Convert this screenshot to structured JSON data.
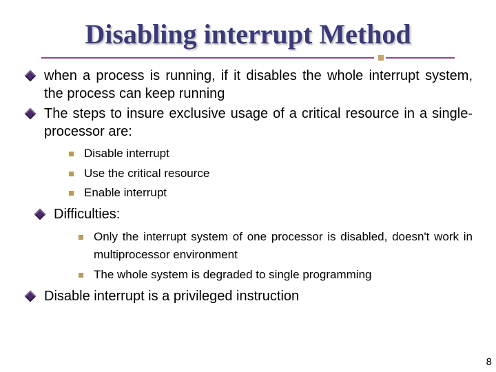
{
  "title": "Disabling interrupt Method",
  "bullets": {
    "b1": "when a process is running, if it disables the whole interrupt system, the process can keep running",
    "b2": "The steps to insure exclusive usage of a critical resource in a single-processor are:",
    "steps": [
      "Disable interrupt",
      "Use the critical resource",
      "Enable interrupt"
    ],
    "b3": "Difficulties:",
    "difficulties": [
      "Only the interrupt system of one processor is disabled, doesn't work in multiprocessor environment",
      "The whole system is degraded to single programming"
    ],
    "b4": "Disable interrupt is a privileged instruction"
  },
  "pageNumber": "8"
}
